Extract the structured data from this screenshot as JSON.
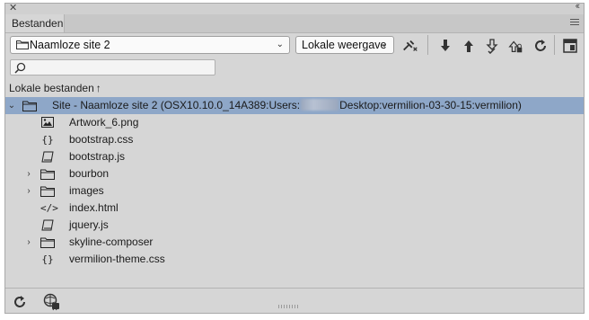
{
  "panel": {
    "tab_label": "Bestanden"
  },
  "toolbar": {
    "site_select_value": "Naamloze site 2",
    "view_select_value": "Lokale weergave"
  },
  "search": {
    "placeholder": ""
  },
  "section": {
    "label": "Lokale bestanden",
    "sort_icon": "↑"
  },
  "tree": {
    "root": {
      "label_prefix": "Site - Naamloze site 2 (OSX10.10.0_14A389:Users:",
      "label_suffix": "Desktop:vermilion-03-30-15:vermilion)"
    },
    "items": [
      {
        "label": "Artwork_6.png",
        "icon": "image-icon",
        "expandable": false
      },
      {
        "label": "bootstrap.css",
        "icon": "css-icon",
        "expandable": false
      },
      {
        "label": "bootstrap.js",
        "icon": "js-icon",
        "expandable": false
      },
      {
        "label": "bourbon",
        "icon": "folder-icon",
        "expandable": true
      },
      {
        "label": "images",
        "icon": "folder-icon",
        "expandable": true
      },
      {
        "label": "index.html",
        "icon": "html-icon",
        "expandable": false
      },
      {
        "label": "jquery.js",
        "icon": "js-icon",
        "expandable": false
      },
      {
        "label": "skyline-composer",
        "icon": "folder-icon",
        "expandable": true
      },
      {
        "label": "vermilion-theme.css",
        "icon": "css-icon",
        "expandable": false
      }
    ]
  },
  "colors": {
    "panel_bg": "#d6d6d6",
    "selection": "#8ea7c8"
  }
}
